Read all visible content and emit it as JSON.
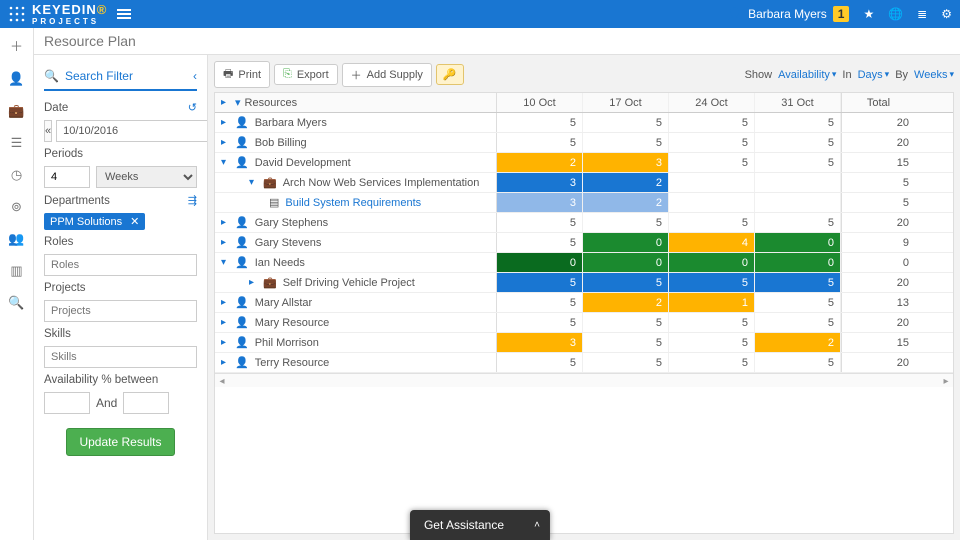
{
  "brand": {
    "name": "KEYEDIN",
    "sub": "PROJECTS"
  },
  "user": {
    "name": "Barbara Myers",
    "badge": "1"
  },
  "page": {
    "title": "Resource Plan"
  },
  "filter": {
    "title": "Search Filter",
    "date_label": "Date",
    "date_value": "10/10/2016",
    "periods_label": "Periods",
    "periods_value": "4",
    "periods_unit": "Weeks",
    "dept_label": "Departments",
    "dept_chip": "PPM Solutions",
    "roles_label": "Roles",
    "roles_ph": "Roles",
    "projects_label": "Projects",
    "projects_ph": "Projects",
    "skills_label": "Skills",
    "skills_ph": "Skills",
    "avail_label": "Availability % between",
    "and": "And",
    "update": "Update Results"
  },
  "toolbar": {
    "print": "Print",
    "export": "Export",
    "add": "Add Supply",
    "show": "Show",
    "avail": "Availability",
    "in": "In",
    "days": "Days",
    "by": "By",
    "weeks": "Weeks"
  },
  "gridhead": {
    "res": "Resources",
    "c1": "10 Oct",
    "c2": "17 Oct",
    "c3": "24 Oct",
    "c4": "31 Oct",
    "total": "Total"
  },
  "rows": [
    {
      "kind": "person",
      "exp": true,
      "label": "Barbara Myers",
      "v": [
        "5",
        "5",
        "5",
        "5"
      ],
      "t": "20",
      "cls": [
        "",
        "",
        "",
        ""
      ]
    },
    {
      "kind": "person",
      "exp": true,
      "label": "Bob Billing",
      "v": [
        "5",
        "5",
        "5",
        "5"
      ],
      "t": "20",
      "cls": [
        "",
        "",
        "",
        ""
      ]
    },
    {
      "kind": "person",
      "exp": true,
      "open": true,
      "label": "David Development",
      "v": [
        "2",
        "3",
        "5",
        "5"
      ],
      "t": "15",
      "cls": [
        "bg-orange",
        "bg-orange",
        "",
        ""
      ]
    },
    {
      "kind": "proj",
      "open": true,
      "label": "Arch Now Web Services Implementation",
      "v": [
        "3",
        "2",
        "",
        "",
        ""
      ],
      "t": "5",
      "cls": [
        "bg-blue",
        "bg-blue",
        "",
        ""
      ]
    },
    {
      "kind": "task",
      "label": "Build System Requirements",
      "v": [
        "3",
        "2",
        "",
        "",
        ""
      ],
      "t": "5",
      "cls": [
        "bg-lblue",
        "bg-lblue",
        "",
        ""
      ]
    },
    {
      "kind": "person",
      "exp": true,
      "label": "Gary Stephens",
      "v": [
        "5",
        "5",
        "5",
        "5"
      ],
      "t": "20",
      "cls": [
        "",
        "",
        "",
        ""
      ]
    },
    {
      "kind": "person",
      "exp": true,
      "label": "Gary Stevens",
      "v": [
        "5",
        "0",
        "4",
        "0"
      ],
      "t": "9",
      "cls": [
        "",
        "bg-green",
        "bg-orange",
        "bg-green"
      ]
    },
    {
      "kind": "person",
      "exp": true,
      "open": true,
      "label": "Ian Needs",
      "v": [
        "0",
        "0",
        "0",
        "0"
      ],
      "t": "0",
      "cls": [
        "bg-dgreen",
        "bg-green",
        "bg-green",
        "bg-green"
      ]
    },
    {
      "kind": "proj",
      "label": "Self Driving Vehicle Project",
      "v": [
        "5",
        "5",
        "5",
        "5"
      ],
      "t": "20",
      "cls": [
        "bg-blue",
        "bg-blue",
        "bg-blue",
        "bg-blue"
      ]
    },
    {
      "kind": "person",
      "exp": true,
      "label": "Mary Allstar",
      "v": [
        "5",
        "2",
        "1",
        "5"
      ],
      "t": "13",
      "cls": [
        "",
        "bg-orange",
        "bg-orange",
        ""
      ]
    },
    {
      "kind": "person",
      "exp": true,
      "label": "Mary Resource",
      "v": [
        "5",
        "5",
        "5",
        "5"
      ],
      "t": "20",
      "cls": [
        "",
        "",
        "",
        ""
      ]
    },
    {
      "kind": "person",
      "exp": true,
      "label": "Phil Morrison",
      "v": [
        "3",
        "5",
        "5",
        "2"
      ],
      "t": "15",
      "cls": [
        "bg-orange",
        "",
        "",
        "bg-orange"
      ]
    },
    {
      "kind": "person",
      "exp": true,
      "label": "Terry Resource",
      "v": [
        "5",
        "5",
        "5",
        "5"
      ],
      "t": "20",
      "cls": [
        "",
        "",
        "",
        ""
      ]
    }
  ],
  "assist": "Get Assistance"
}
